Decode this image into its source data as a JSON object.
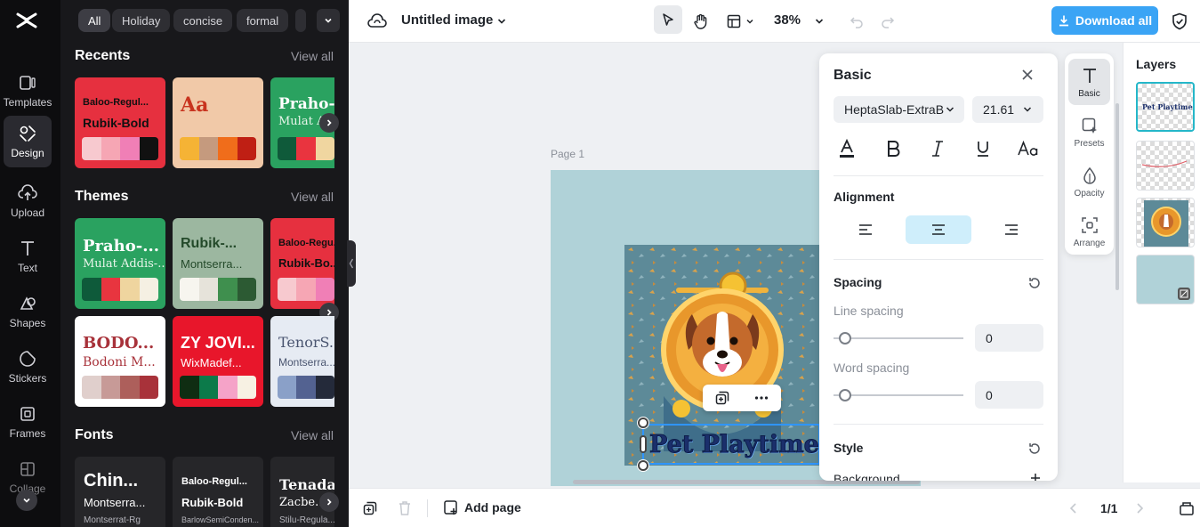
{
  "rail": {
    "items": [
      {
        "label": "Templates",
        "icon": "templates-icon"
      },
      {
        "label": "Design",
        "icon": "design-icon"
      },
      {
        "label": "Upload",
        "icon": "upload-icon"
      },
      {
        "label": "Text",
        "icon": "text-icon"
      },
      {
        "label": "Shapes",
        "icon": "shapes-icon"
      },
      {
        "label": "Stickers",
        "icon": "stickers-icon"
      },
      {
        "label": "Frames",
        "icon": "frames-icon"
      },
      {
        "label": "Collage",
        "icon": "collage-icon"
      }
    ]
  },
  "design_panel": {
    "chips": [
      "All",
      "Holiday",
      "concise",
      "formal"
    ],
    "recents": {
      "title": "Recents",
      "view_all": "View all",
      "cards": [
        {
          "line1": "Baloo-Regul...",
          "line2": "Rubik-Bold",
          "swatches": [
            "#f7c9cf",
            "#f6a6b4",
            "#f07fb6",
            "#111111"
          ],
          "bg": "#e6303f"
        },
        {
          "big": "Aa",
          "swatches": [
            "#f5b335",
            "#c59a7e",
            "#f06d1b",
            "#bf1f14"
          ],
          "bg": "#f1c9a8"
        },
        {
          "line1": "Praho-...",
          "line2": "Mulat A...",
          "swatches": [
            "#0f5a3a",
            "#e9343f",
            "#f0d6a0",
            "#f3efe1"
          ],
          "bg": "#2aa260"
        }
      ]
    },
    "themes": {
      "title": "Themes",
      "view_all": "View all",
      "cards": [
        {
          "line1": "Praho-...",
          "line2": "Mulat Addis-...",
          "swatches": [
            "#0e5a3a",
            "#e8353f",
            "#efd59f",
            "#f5f0e3"
          ],
          "bg": "#2aa260",
          "color": "#ffffff"
        },
        {
          "line1": "Rubik-...",
          "line2": "Montserra...",
          "swatches": [
            "#f7f5ef",
            "#e6e3da",
            "#3f8f4e",
            "#2c5a33"
          ],
          "bg": "#9cb7a0",
          "color": "#244a2a"
        },
        {
          "line1": "Baloo-Regu...",
          "line2": "Rubik-Bo...",
          "swatches": [
            "#f7c9cf",
            "#f6a6b4",
            "#f07fb6",
            "#111111"
          ],
          "bg": "#e6303f",
          "color": "#111111"
        },
        {
          "line1": "BODO...",
          "line2": "Bodoni M...",
          "swatches": [
            "#e0cfcc",
            "#c79a97",
            "#ad5f5b",
            "#a8323a"
          ],
          "bg": "#ffffff",
          "color": "#a8323a"
        },
        {
          "line1": "ZY JOVI...",
          "line2": "WixMadef...",
          "swatches": [
            "#0f2d12",
            "#0c7a4a",
            "#f5a3c8",
            "#f7f1e3"
          ],
          "bg": "#e8162b",
          "color": "#ffffff"
        },
        {
          "line1": "TenorS...",
          "line2": "Montserra...",
          "swatches": [
            "#8aa0c8",
            "#536291",
            "#242a3a",
            "#242a3a"
          ],
          "bg": "#e6ebf3",
          "color": "#4a5570"
        }
      ]
    },
    "fonts": {
      "title": "Fonts",
      "view_all": "View all",
      "cards": [
        {
          "line1": "Chin...",
          "line2": "Montserra...",
          "line3": "Montserrat-Rg"
        },
        {
          "line1": "Baloo-Regul...",
          "line2": "Rubik-Bold",
          "line3": "BarlowSemiConden..."
        },
        {
          "line1": "Tenada...",
          "line2": "Zacbe...",
          "line3": "Stilu-Regula..."
        }
      ]
    }
  },
  "topbar": {
    "doc_title": "Untitled image",
    "zoom": "38%",
    "download_label": "Download all"
  },
  "canvas": {
    "page_label": "Page 1",
    "text_layer": "Pet Playtime"
  },
  "props": {
    "title": "Basic",
    "font_family": "HeptaSlab-ExtraB",
    "font_size": "21.61",
    "alignment_title": "Alignment",
    "spacing_title": "Spacing",
    "line_spacing_label": "Line spacing",
    "line_spacing_value": "0",
    "word_spacing_label": "Word spacing",
    "word_spacing_value": "0",
    "style_title": "Style",
    "background_label": "Background"
  },
  "side_strip": {
    "items": [
      {
        "label": "Basic"
      },
      {
        "label": "Presets"
      },
      {
        "label": "Opacity"
      },
      {
        "label": "Arrange"
      }
    ]
  },
  "layers": {
    "title": "Layers",
    "thumb_text": "Pet Playtime"
  },
  "bottombar": {
    "add_page": "Add page",
    "page_count": "1/1"
  },
  "colors": {
    "accent": "#3aa4f5",
    "selection": "#2f95ff",
    "active_align": "#cfeefb",
    "canvas_bg": "#b0d2d8"
  }
}
